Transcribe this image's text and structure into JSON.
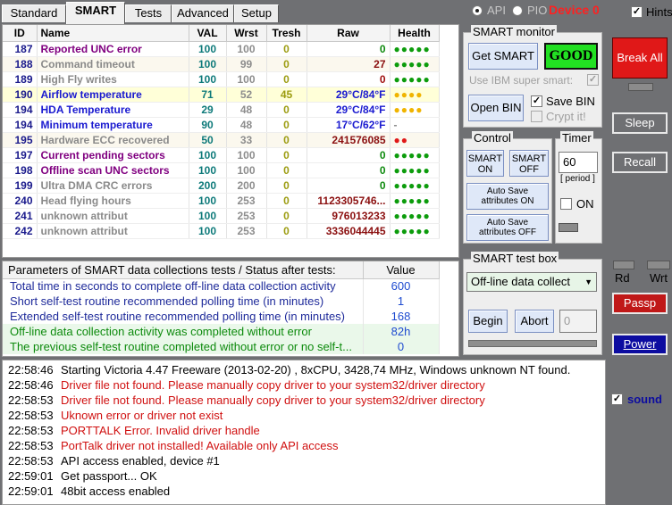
{
  "tabs": [
    {
      "label": "Standard"
    },
    {
      "label": "SMART"
    },
    {
      "label": "Tests"
    },
    {
      "label": "Advanced"
    },
    {
      "label": "Setup"
    }
  ],
  "mode": {
    "api_label": "API",
    "pio_label": "PIO",
    "device_label": "Device 0",
    "hints_label": "Hints"
  },
  "smart_table": {
    "headers": {
      "id": "ID",
      "name": "Name",
      "val": "VAL",
      "wrst": "Wrst",
      "tresh": "Tresh",
      "raw": "Raw",
      "health": "Health"
    },
    "rows": [
      {
        "id": "187",
        "name": "Reported UNC error",
        "val": "100",
        "wrst": "100",
        "tresh": "0",
        "raw": "0",
        "health": "●●●●●"
      },
      {
        "id": "188",
        "name": "Command timeout",
        "val": "100",
        "wrst": "99",
        "tresh": "0",
        "raw": "27",
        "health": "●●●●●"
      },
      {
        "id": "189",
        "name": "High Fly writes",
        "val": "100",
        "wrst": "100",
        "tresh": "0",
        "raw": "0",
        "health": "●●●●●"
      },
      {
        "id": "190",
        "name": "Airflow temperature",
        "val": "71",
        "wrst": "52",
        "tresh": "45",
        "raw": "29°C/84°F",
        "health": "●●●●"
      },
      {
        "id": "194",
        "name": "HDA Temperature",
        "val": "29",
        "wrst": "48",
        "tresh": "0",
        "raw": "29°C/84°F",
        "health": "●●●●"
      },
      {
        "id": "194",
        "name": "Minimum temperature",
        "val": "90",
        "wrst": "48",
        "tresh": "0",
        "raw": "17°C/62°F",
        "health": "-"
      },
      {
        "id": "195",
        "name": "Hardware ECC recovered",
        "val": "50",
        "wrst": "33",
        "tresh": "0",
        "raw": "241576085",
        "health": "●●"
      },
      {
        "id": "197",
        "name": "Current pending sectors",
        "val": "100",
        "wrst": "100",
        "tresh": "0",
        "raw": "0",
        "health": "●●●●●"
      },
      {
        "id": "198",
        "name": "Offline scan UNC sectors",
        "val": "100",
        "wrst": "100",
        "tresh": "0",
        "raw": "0",
        "health": "●●●●●"
      },
      {
        "id": "199",
        "name": "Ultra DMA CRC errors",
        "val": "200",
        "wrst": "200",
        "tresh": "0",
        "raw": "0",
        "health": "●●●●●"
      },
      {
        "id": "240",
        "name": "Head flying hours",
        "val": "100",
        "wrst": "253",
        "tresh": "0",
        "raw": "1123305746...",
        "health": "●●●●●"
      },
      {
        "id": "241",
        "name": "unknown attribut",
        "val": "100",
        "wrst": "253",
        "tresh": "0",
        "raw": "976013233",
        "health": "●●●●●"
      },
      {
        "id": "242",
        "name": "unknown attribut",
        "val": "100",
        "wrst": "253",
        "tresh": "0",
        "raw": "3336044445",
        "health": "●●●●●"
      }
    ]
  },
  "params_table": {
    "header": "Parameters of SMART data collections tests / Status after tests:",
    "value_header": "Value",
    "rows": [
      {
        "label": "Total time in seconds to complete off-line data collection activity",
        "value": "600"
      },
      {
        "label": "Short self-test routine recommended polling time (in minutes)",
        "value": "1"
      },
      {
        "label": "Extended self-test routine recommended polling time (in minutes)",
        "value": "168"
      },
      {
        "label": "Off-line data collection activity was completed without error",
        "value": "82h"
      },
      {
        "label": "The previous self-test routine completed without error or no self-t...",
        "value": "0"
      }
    ]
  },
  "smart_monitor": {
    "title": "SMART monitor",
    "get_smart": "Get SMART",
    "status": "GOOD",
    "ibm_label": "Use IBM super smart:",
    "open_bin": "Open BIN",
    "save_bin": "Save BIN",
    "crypt": "Crypt it!"
  },
  "control": {
    "title": "Control",
    "smart_on": "SMART ON",
    "smart_off": "SMART OFF",
    "autosave_on": "Auto Save attributes ON",
    "autosave_off": "Auto Save attributes OFF"
  },
  "timer": {
    "title": "Timer",
    "value": "60",
    "period": "[ period ]",
    "on": "ON"
  },
  "test_box": {
    "title": "SMART test box",
    "selected": "Off-line data collect",
    "begin": "Begin",
    "abort": "Abort",
    "count": "0"
  },
  "right_panel": {
    "break_all": "Break All",
    "sleep": "Sleep",
    "recall": "Recall",
    "rd": "Rd",
    "wrt": "Wrt",
    "passp": "Passp",
    "power": "Power",
    "sound": "sound"
  },
  "log": [
    {
      "time": "22:58:46",
      "msg": "Starting Victoria 4.47  Freeware (2013-02-20) , 8xCPU, 3428,74 MHz, Windows unknown NT found."
    },
    {
      "time": "22:58:46",
      "msg": "Driver file not found. Please manually copy driver to your system32/driver directory"
    },
    {
      "time": "22:58:53",
      "msg": "Driver file not found. Please manually copy driver to your system32/driver directory"
    },
    {
      "time": "22:58:53",
      "msg": "Uknown error or driver not exist"
    },
    {
      "time": "22:58:53",
      "msg": "PORTTALK Error. Invalid driver handle"
    },
    {
      "time": "22:58:53",
      "msg": "PortTalk driver not installed! Available only API access"
    },
    {
      "time": "22:58:53",
      "msg": "API access enabled, device #1"
    },
    {
      "time": "22:59:01",
      "msg": "Get passport... OK"
    },
    {
      "time": "22:59:01",
      "msg": "48bit access enabled"
    }
  ],
  "colors": {
    "device": "#ff2020",
    "good_bg": "#22e022",
    "break_all": "#e01818",
    "passp": "#c01818",
    "power": "#0c0ca0",
    "log_error": "#d01010",
    "log_normal": "#000000"
  }
}
